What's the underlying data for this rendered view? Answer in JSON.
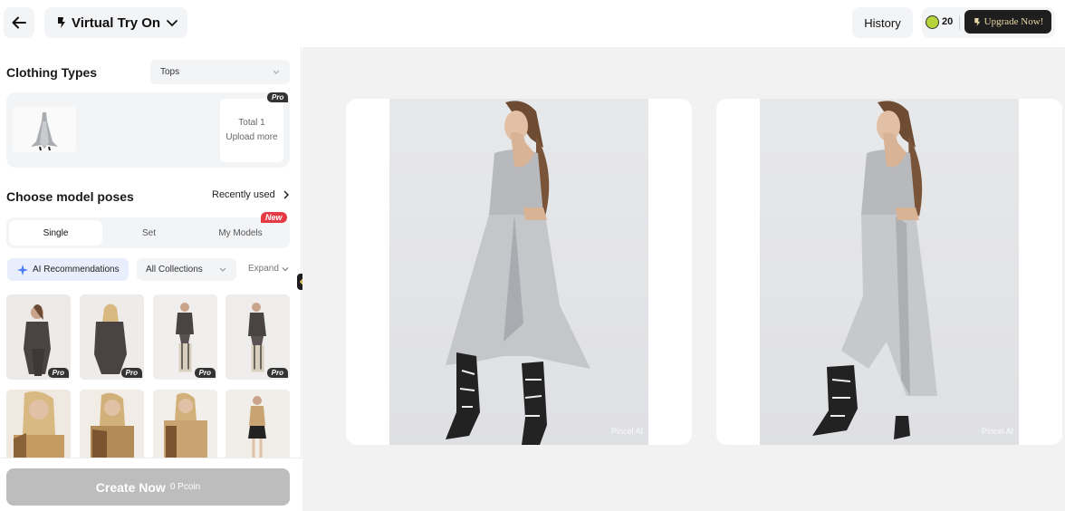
{
  "header": {
    "back_icon": "arrow-left-icon",
    "app_icon": "pincel-logo-icon",
    "title": "Virtual Try On",
    "title_chevron": "chevron-down-icon",
    "history_label": "History",
    "coins": "20",
    "upgrade_label": "Upgrade Now!"
  },
  "clothing": {
    "title": "Clothing Types",
    "type_selected": "Tops",
    "pro_badge": "Pro",
    "total": "Total 1",
    "upload_more": "Upload more"
  },
  "poses": {
    "title": "Choose model poses",
    "recently_used": "Recently used",
    "tabs": [
      "Single",
      "Set",
      "My Models"
    ],
    "active_tab": "Single",
    "new_badge": "New",
    "ai_label": "AI Recommendations",
    "collections_label": "All Collections",
    "expand_label": "Expand",
    "pro_badge": "Pro"
  },
  "create": {
    "label": "Create Now",
    "cost": "0 Pcoin"
  },
  "results": {
    "watermark": "Pincel AI"
  },
  "colors": {
    "accent": "#1e1e1e",
    "new_badge": "#e53946",
    "coin": "#b7d33b",
    "ai_chip": "#e8eefc"
  }
}
